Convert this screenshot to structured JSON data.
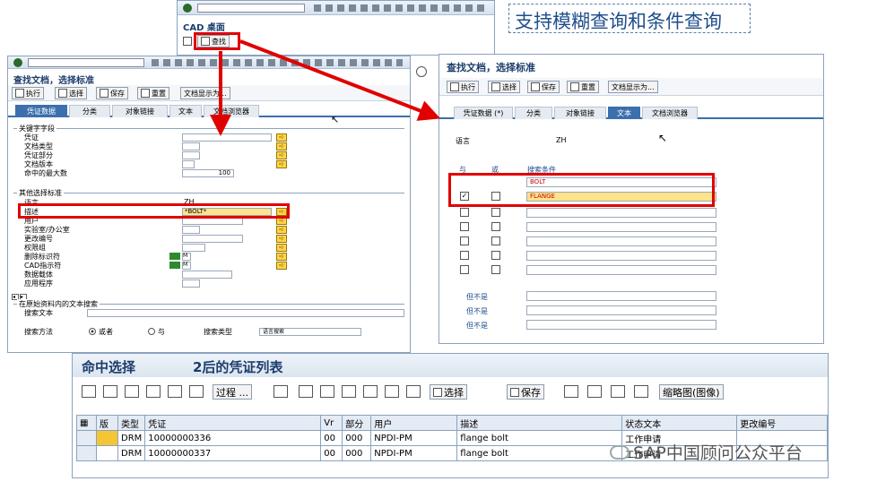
{
  "top_window": {
    "title": "CAD 桌面",
    "find_button": "查找"
  },
  "callout": "支持模糊查询和条件查询",
  "left_window": {
    "title": "查找文档，选择标准",
    "toolbar": [
      "执行",
      "选择",
      "保存",
      "重置",
      "文档显示为..."
    ],
    "tabs": [
      "凭证数据",
      "分类",
      "对象链接",
      "文本",
      "文档浏览器"
    ],
    "group_key": "关键字字段",
    "key_fields": [
      "凭证",
      "文档类型",
      "凭证部分",
      "文档版本",
      "命中的最大数"
    ],
    "max_hits": "100",
    "group_other": "其他选择标准",
    "other_fields": [
      "语言",
      "描述",
      "用户",
      "实验室/办公室",
      "更改编号",
      "权限组",
      "删除标识符",
      "CAD指示符",
      "数据载体",
      "应用程序"
    ],
    "language_value": "ZH",
    "description_value": "*BOLT*",
    "flag_value": "M",
    "group_text": "在原始资料内的文本搜索",
    "search_text_label": "搜索文本",
    "search_method_label": "搜索方法",
    "radio_or": "或者",
    "radio_and": "与",
    "search_type_label": "搜索类型",
    "search_type_value": "语言搜索"
  },
  "right_window": {
    "title": "查找文档，选择标准",
    "toolbar": [
      "执行",
      "选择",
      "保存",
      "重置",
      "文档显示为..."
    ],
    "tabs": [
      "凭证数据 (*)",
      "分类",
      "对象链接",
      "文本",
      "文档浏览器"
    ],
    "language_label": "语言",
    "language_value": "ZH",
    "col_and": "与",
    "col_or": "或",
    "col_cond": "搜索条件",
    "cond1": "BOLT",
    "cond2": "FLANGE",
    "but_not": [
      "但不是",
      "但不是",
      "但不是"
    ]
  },
  "result": {
    "title": "命中选择",
    "subtitle": "2后的凭证列表",
    "toolbar": [
      "过程 ...",
      "选择",
      "保存",
      "缩略图(图像)"
    ],
    "columns": [
      "版",
      "类型",
      "凭证",
      "Vr",
      "部分",
      "用户",
      "描述",
      "状态文本",
      "更改编号"
    ],
    "rows": [
      {
        "type": "DRM",
        "doc": "10000000336",
        "vr": "00",
        "part": "000",
        "user": "NPDI-PM",
        "desc": "flange bolt",
        "status": "工作申请",
        "change": ""
      },
      {
        "type": "DRM",
        "doc": "10000000337",
        "vr": "00",
        "part": "000",
        "user": "NPDI-PM",
        "desc": "flange bolt",
        "status": "工作申请",
        "change": ""
      }
    ]
  },
  "watermark": "SAP中国顾问公众平台",
  "colors": {
    "highlight": "#e00000",
    "accent": "#3b6fae",
    "field_yellow": "#ffe38a"
  }
}
